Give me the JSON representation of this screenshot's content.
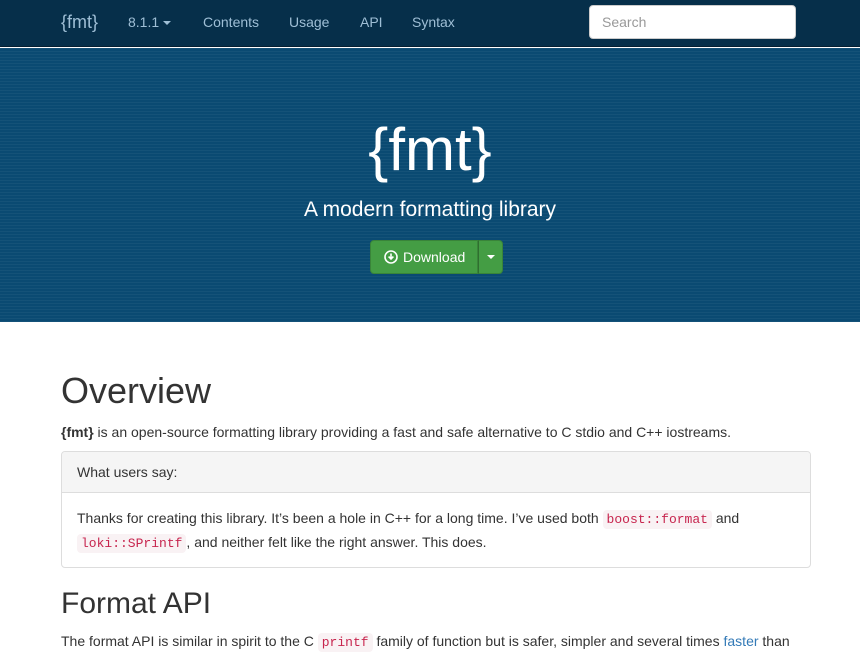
{
  "navbar": {
    "brand": "{fmt}",
    "version": "8.1.1",
    "items": [
      "Contents",
      "Usage",
      "API",
      "Syntax"
    ],
    "search_placeholder": "Search"
  },
  "hero": {
    "title": "{fmt}",
    "subtitle": "A modern formatting library",
    "download_label": "Download",
    "download_icon": "download-circle-icon"
  },
  "overview": {
    "heading": "Overview",
    "intro_bold": "{fmt}",
    "intro_rest": " is an open-source formatting library providing a fast and safe alternative to C stdio and C++ iostreams."
  },
  "testimonial": {
    "header": "What users say:",
    "text_1": "Thanks for creating this library. It’s been a hole in C++ for a long time. I’ve used both ",
    "code_1": "boost::format",
    "text_2": " and ",
    "code_2": "loki::SPrintf",
    "text_3": ", and neither felt like the right answer. This does."
  },
  "format_api": {
    "heading": "Format API",
    "text_1": "The format API is similar in spirit to the C ",
    "code_1": "printf",
    "text_2": " family of function but is safer, simpler and several times ",
    "link_1": "faster",
    "text_3": " than"
  },
  "colors": {
    "navbar_bg": "#062f4a",
    "hero_bg": "#0a4a72",
    "button_green": "#449d44",
    "link": "#337ab7",
    "code": "#c7254e"
  }
}
